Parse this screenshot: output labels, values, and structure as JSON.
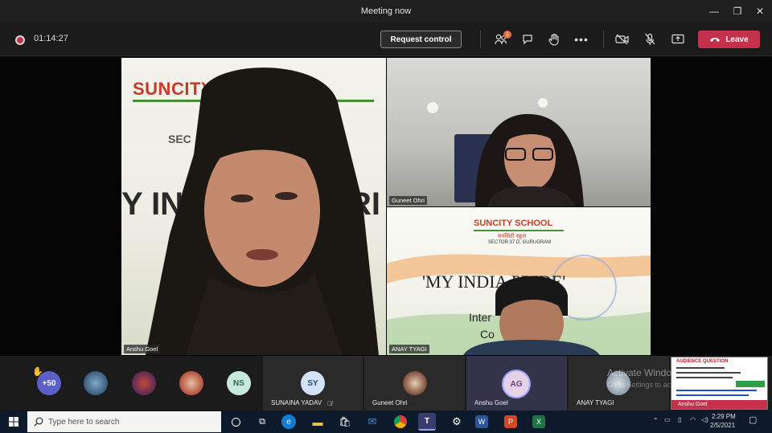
{
  "window": {
    "title": "Meeting now",
    "minimize": "—",
    "maximize": "❐",
    "close": "✕"
  },
  "toolbar": {
    "timer": "01:14:27",
    "request_control": "Request control",
    "participants_badge": "1",
    "leave_label": "Leave"
  },
  "main_video": {
    "school_banner": "SUNCITY SCHOOL",
    "banner_fragment_1": "SEC",
    "banner_fragment_2": "Y IN",
    "banner_fragment_3": "RI",
    "name": "Anshu Goel"
  },
  "video_guneet": {
    "name": "Guneet Ohri"
  },
  "video_anay": {
    "school_banner": "SUNCITY SCHOOL",
    "school_hindi": "सनसिटी स्कूल",
    "school_sector": "SECTOR 37 D, GURUGRAM",
    "slide_title": "'MY INDIA PRIDE'",
    "slide_line_1": "Inter",
    "slide_line_2": "Co",
    "name": "ANAY TYAGI"
  },
  "participants_bar": {
    "overflow_count": "+50",
    "ns_initials": "NS",
    "tiles": [
      {
        "initials": "SY",
        "name": "SUNAINA YADAV"
      },
      {
        "name": "Guneet Ohri"
      },
      {
        "initials": "AG",
        "name": "Anshu Goel"
      },
      {
        "name": "ANAY TYAGI"
      }
    ],
    "watermark_1": "Activate Windows",
    "watermark_2": "Go to Settings to activate Windows.",
    "preview_title": "AUDIENCE QUESTION",
    "preview_name": "Anshu Goel"
  },
  "taskbar": {
    "search_placeholder": "Type here to search",
    "time": "2:29 PM",
    "date": "2/5/2021"
  }
}
